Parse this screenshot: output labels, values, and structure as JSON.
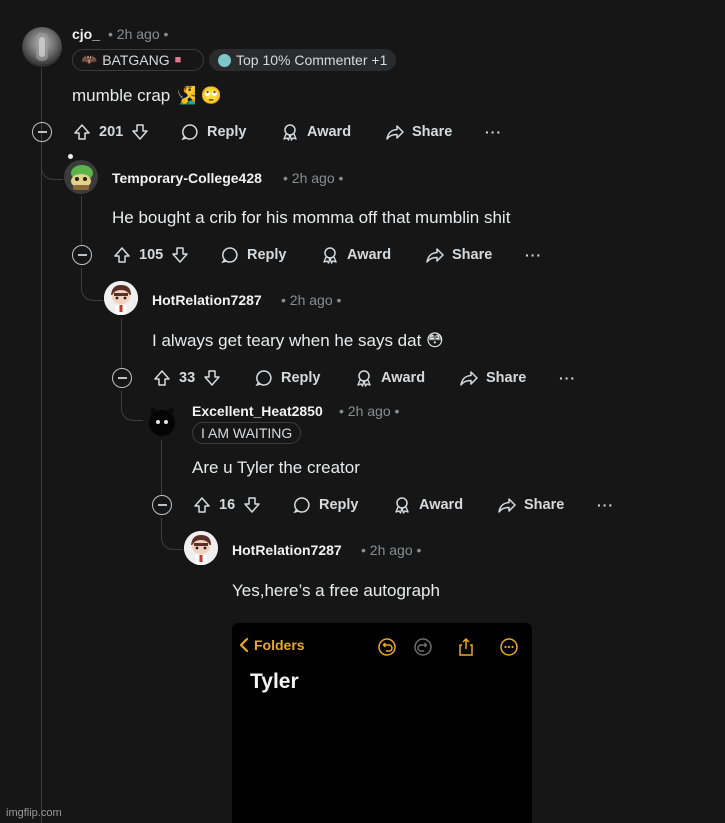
{
  "comments": [
    {
      "username": "cjo_",
      "meta": "• 2h ago •",
      "flairs": [
        "BATGANG",
        "Top 10% Commenter +1"
      ],
      "body": "mumble crap 🧏‍♂️ 🙄",
      "votes": "201"
    },
    {
      "username": "Temporary-College428",
      "meta": "• 2h ago •",
      "body": "He bought a crib for his momma off that mumblin shit",
      "votes": "105"
    },
    {
      "username": "HotRelation7287",
      "meta": "• 2h ago •",
      "body": "I always get teary when he says dat 😳",
      "votes": "33"
    },
    {
      "username": "Excellent_Heat2850",
      "meta": "• 2h ago •",
      "flairs": [
        "I AM WAITING"
      ],
      "body": "Are u Tyler the creator",
      "votes": "16"
    },
    {
      "username": "HotRelation7287",
      "meta": "• 2h ago •",
      "body": "Yes,here’s a free autograph"
    }
  ],
  "actions": {
    "reply": "Reply",
    "award": "Award",
    "share": "Share",
    "more": "···"
  },
  "attachment": {
    "back_label": "Folders",
    "note_title": "Tyler",
    "accent": "#e8a82a"
  },
  "watermark": "imgflip.com",
  "icons": [
    "collapse-icon",
    "upvote-icon",
    "downvote-icon",
    "comment-icon",
    "award-icon",
    "share-icon",
    "more-icon",
    "chevron-left-icon",
    "undo-icon",
    "redo-icon",
    "upload-icon",
    "ellipsis-circle-icon"
  ]
}
